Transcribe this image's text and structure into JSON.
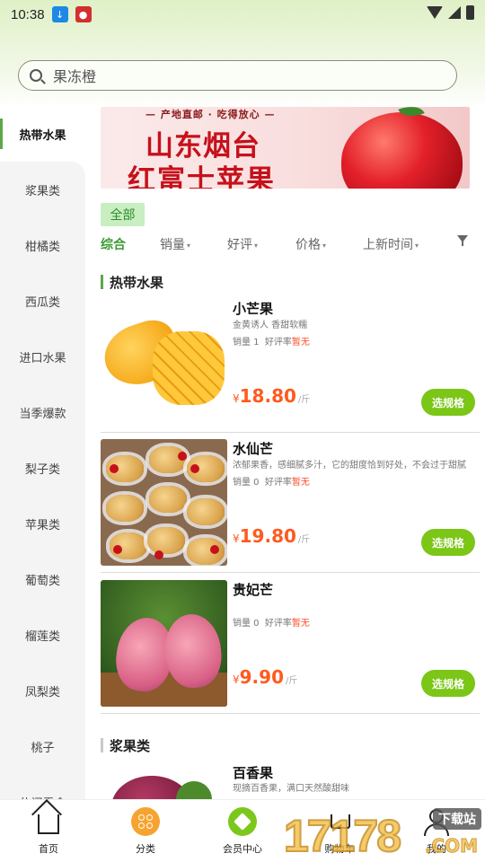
{
  "status_bar": {
    "time": "10:38"
  },
  "search": {
    "value": "果冻橙"
  },
  "sidebar": {
    "items": [
      {
        "label": "热带水果"
      },
      {
        "label": "浆果类"
      },
      {
        "label": "柑橘类"
      },
      {
        "label": "西瓜类"
      },
      {
        "label": "进口水果"
      },
      {
        "label": "当季爆款"
      },
      {
        "label": "梨子类"
      },
      {
        "label": "苹果类"
      },
      {
        "label": "葡萄类"
      },
      {
        "label": "榴莲类"
      },
      {
        "label": "凤梨类"
      },
      {
        "label": "桃子"
      },
      {
        "label": "休闲零食"
      }
    ]
  },
  "banner": {
    "slogan": "— 产地直邮 · 吃得放心 —",
    "title_line1": "山东烟台",
    "title_line2": "红富士苹果"
  },
  "filter_chip": "全部",
  "sort": {
    "comprehensive": "综合",
    "sales": "销量",
    "rating": "好评",
    "price": "价格",
    "newest": "上新时间"
  },
  "sections": [
    {
      "title": "热带水果",
      "products": [
        {
          "name": "小芒果",
          "desc": "金黄诱人  香甜软糯",
          "sales_label": "销量 1",
          "rating_label": "好评率",
          "rating_value": "暂无",
          "currency": "¥",
          "price": "18.80",
          "unit": "/斤",
          "button": "选规格"
        },
        {
          "name": "水仙芒",
          "desc": "浓郁果香，感细腻多汁，它的甜度恰到好处，不会过于甜腻",
          "sales_label": "销量 0",
          "rating_label": "好评率",
          "rating_value": "暂无",
          "currency": "¥",
          "price": "19.80",
          "unit": "/斤",
          "button": "选规格"
        },
        {
          "name": "贵妃芒",
          "desc": "",
          "sales_label": "销量 0",
          "rating_label": "好评率",
          "rating_value": "暂无",
          "currency": "¥",
          "price": "9.90",
          "unit": "/斤",
          "button": "选规格"
        }
      ]
    },
    {
      "title": "浆果类",
      "products": [
        {
          "name": "百香果",
          "desc": "现摘百香果，满口天然酸甜味"
        }
      ]
    }
  ],
  "tabbar": {
    "items": [
      {
        "label": "首页"
      },
      {
        "label": "分类"
      },
      {
        "label": "会员中心"
      },
      {
        "label": "购物车"
      },
      {
        "label": "我的"
      }
    ]
  },
  "watermark": {
    "digits": "17178",
    "badge": "下载站",
    "suffix": ".COM"
  },
  "colors": {
    "accent_green": "#5aa84b",
    "button_green": "#7bc617",
    "price_orange": "#ff5a1f",
    "category_orange": "#f7a330"
  }
}
